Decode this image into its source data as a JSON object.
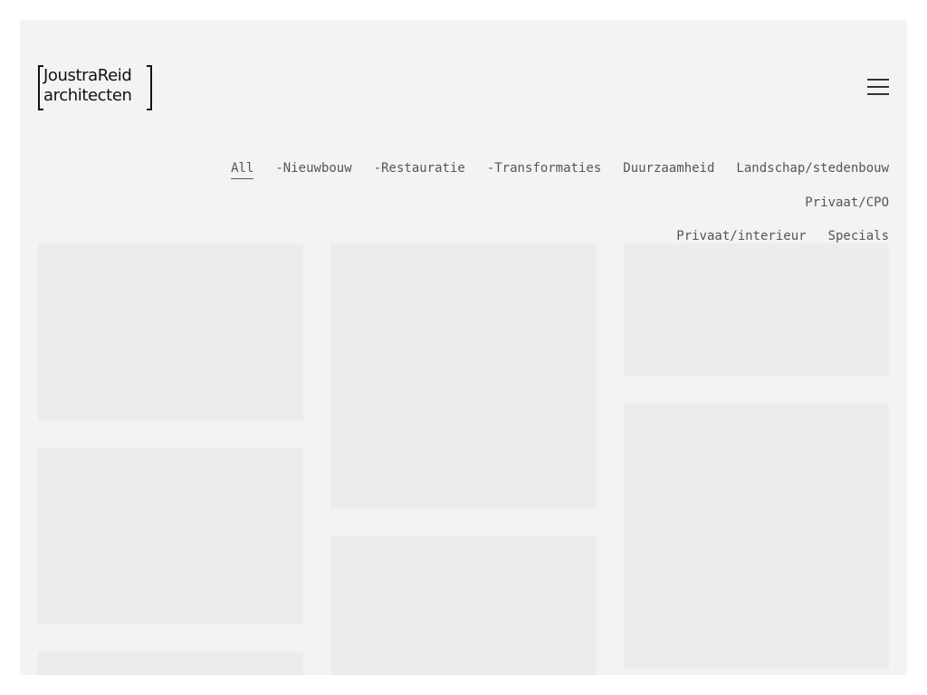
{
  "brand": {
    "line1": "JoustraReid",
    "line2": "architecten"
  },
  "filters": [
    {
      "label": "All",
      "active": true
    },
    {
      "label": "-Nieuwbouw"
    },
    {
      "label": "-Restauratie"
    },
    {
      "label": "-Transformaties"
    },
    {
      "label": "Duurzaamheid"
    },
    {
      "label": "Landschap/stedenbouw"
    },
    {
      "label": "Privaat/CPO"
    },
    {
      "label": "Privaat/interieur"
    },
    {
      "label": "Specials"
    }
  ],
  "icons": {
    "menu": "hamburger-menu-icon"
  },
  "colors": {
    "frame_background": "#f3f3f3",
    "placeholder_tile": "#ececec",
    "text": "#555555",
    "logo": "#111111"
  }
}
